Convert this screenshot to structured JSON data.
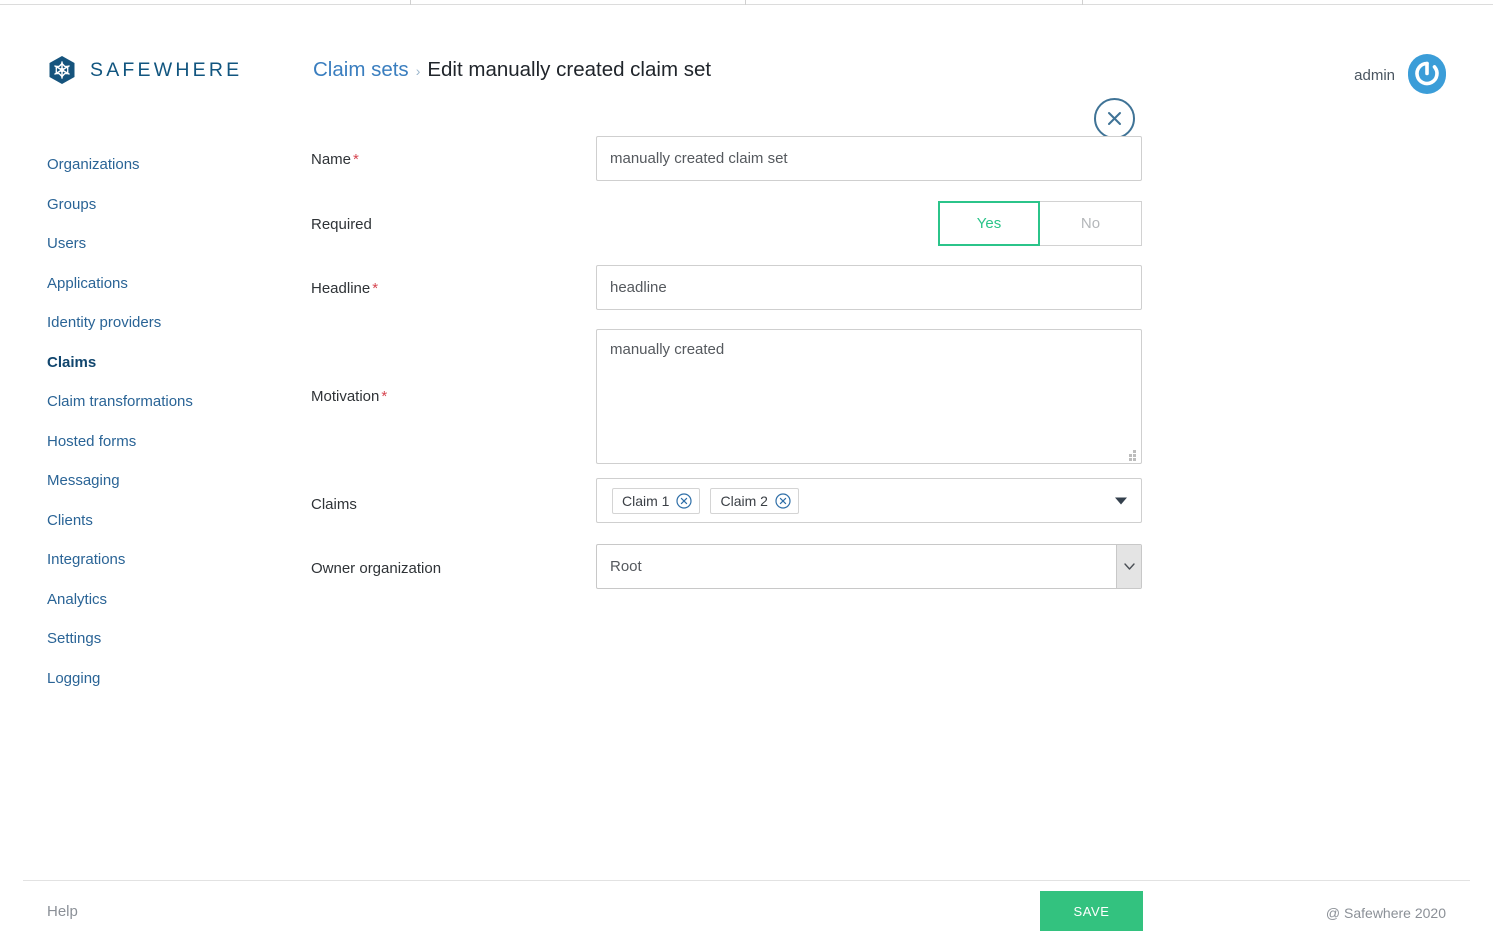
{
  "brand": {
    "name": "SAFEWHERE",
    "logo_icon": "snowflake-hexagon-icon",
    "color": "#11557f"
  },
  "header": {
    "breadcrumb": {
      "parent": "Claim sets",
      "separator": "›",
      "current": "Edit manually created claim set"
    },
    "close_icon": "close-circle-icon",
    "user": {
      "name": "admin",
      "avatar_icon": "power-avatar-icon"
    }
  },
  "sidebar": {
    "items": [
      {
        "label": "Organizations",
        "active": false
      },
      {
        "label": "Groups",
        "active": false
      },
      {
        "label": "Users",
        "active": false
      },
      {
        "label": "Applications",
        "active": false
      },
      {
        "label": "Identity providers",
        "active": false
      },
      {
        "label": "Claims",
        "active": true
      },
      {
        "label": "Claim transformations",
        "active": false
      },
      {
        "label": "Hosted forms",
        "active": false
      },
      {
        "label": "Messaging",
        "active": false
      },
      {
        "label": "Clients",
        "active": false
      },
      {
        "label": "Integrations",
        "active": false
      },
      {
        "label": "Analytics",
        "active": false
      },
      {
        "label": "Settings",
        "active": false
      },
      {
        "label": "Logging",
        "active": false
      }
    ]
  },
  "form": {
    "name": {
      "label": "Name",
      "required_marker": "*",
      "value": "manually created claim set",
      "placeholder": "Name"
    },
    "required": {
      "label": "Required",
      "yes_label": "Yes",
      "no_label": "No",
      "selected": "Yes",
      "selected_color": "#2bc48a"
    },
    "headline": {
      "label": "Headline",
      "required_marker": "*",
      "value": "headline",
      "placeholder": "Headline"
    },
    "motivation": {
      "label": "Motivation",
      "required_marker": "*",
      "value": "manually created",
      "placeholder": "Motivation",
      "resize_grip_icon": "resize-grip-icon"
    },
    "claims": {
      "label": "Claims",
      "chips": [
        {
          "label": "Claim 1",
          "remove_icon": "remove-circle-icon"
        },
        {
          "label": "Claim 2",
          "remove_icon": "remove-circle-icon"
        }
      ],
      "caret_icon": "caret-down-icon"
    },
    "owner_organization": {
      "label": "Owner organization",
      "value": "Root",
      "options": [
        "Root"
      ],
      "arrow_icon": "chevron-down-icon"
    }
  },
  "footer": {
    "help_label": "Help",
    "save_label": "SAVE",
    "save_color": "#33c27f",
    "copyright": "@ Safewhere 2020"
  }
}
